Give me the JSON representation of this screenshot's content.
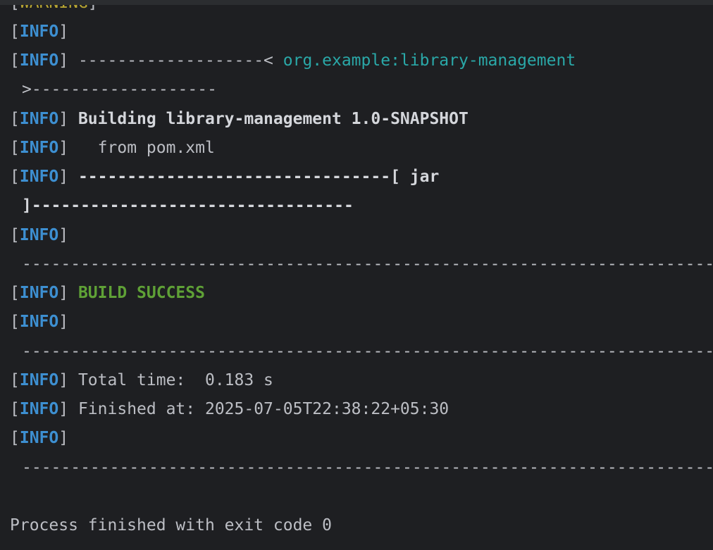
{
  "warning_line": {
    "open": "[",
    "level": "WARNING",
    "close": "]"
  },
  "info_level": "INFO",
  "lines": [
    {
      "text": ""
    },
    {
      "text": "-------------------< ",
      "artifact": "org.example:library-management"
    },
    {
      "text": ">-------------------"
    },
    {
      "text": "Building library-management 1.0-SNAPSHOT"
    },
    {
      "text": "  from pom.xml"
    },
    {
      "text": "--------------------------------[ jar"
    },
    {
      "text": "]---------------------------------"
    },
    {
      "text": ""
    },
    {
      "text": "------------------------------------------------------------------------"
    },
    {
      "text": "BUILD SUCCESS"
    },
    {
      "text": ""
    },
    {
      "text": "------------------------------------------------------------------------"
    },
    {
      "text": "Total time:  0.183 s"
    },
    {
      "text": "Finished at: 2025-07-05T22:38:22+05:30"
    },
    {
      "text": ""
    },
    {
      "text": "------------------------------------------------------------------------"
    }
  ],
  "process_exit": "Process finished with exit code 0",
  "colors": {
    "background": "#1e1f22",
    "info": "#3d8fd1",
    "warning": "#b8a532",
    "success": "#5fa136",
    "artifact": "#2aa8a8",
    "text": "#bcbec4"
  }
}
